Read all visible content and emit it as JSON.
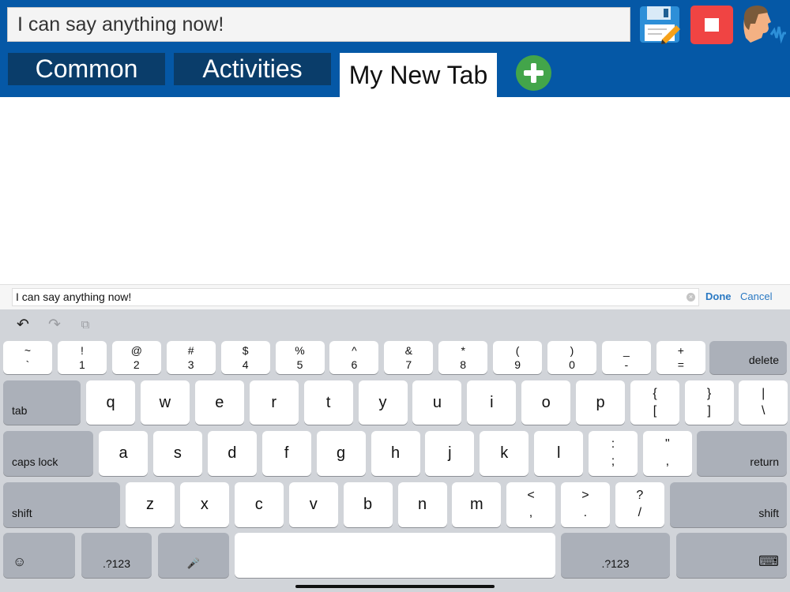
{
  "header": {
    "message_text": "I can say anything now!",
    "tabs": [
      {
        "label": "Common",
        "active": false
      },
      {
        "label": "Activities",
        "active": false
      },
      {
        "label": "My New Tab",
        "active": true
      }
    ],
    "icons": {
      "add": "add-tab-icon",
      "save": "save-icon",
      "stop": "stop-icon",
      "speak": "speak-icon"
    }
  },
  "edit_bar": {
    "value": "I can say anything now!",
    "clear": "×",
    "done": "Done",
    "cancel": "Cancel"
  },
  "toolbar": {
    "undo": "↶",
    "redo": "↷",
    "paste": "⧉"
  },
  "keyboard": {
    "row1": [
      {
        "top": "~",
        "bottom": "`"
      },
      {
        "top": "!",
        "bottom": "1"
      },
      {
        "top": "@",
        "bottom": "2"
      },
      {
        "top": "#",
        "bottom": "3"
      },
      {
        "top": "$",
        "bottom": "4"
      },
      {
        "top": "%",
        "bottom": "5"
      },
      {
        "top": "^",
        "bottom": "6"
      },
      {
        "top": "&",
        "bottom": "7"
      },
      {
        "top": "*",
        "bottom": "8"
      },
      {
        "top": "(",
        "bottom": "9"
      },
      {
        "top": ")",
        "bottom": "0"
      },
      {
        "top": "_",
        "bottom": "-"
      },
      {
        "top": "+",
        "bottom": "="
      }
    ],
    "delete": "delete",
    "tab": "tab",
    "row2": [
      "q",
      "w",
      "e",
      "r",
      "t",
      "y",
      "u",
      "i",
      "o",
      "p"
    ],
    "row2_sym": [
      {
        "top": "{",
        "bottom": "["
      },
      {
        "top": "}",
        "bottom": "]"
      },
      {
        "top": "|",
        "bottom": "\\"
      }
    ],
    "caps_lock": "caps lock",
    "row3": [
      "a",
      "s",
      "d",
      "f",
      "g",
      "h",
      "j",
      "k",
      "l"
    ],
    "row3_sym": [
      {
        "top": ":",
        "bottom": ";"
      },
      {
        "top": "\"",
        "bottom": ","
      }
    ],
    "return": "return",
    "shift": "shift",
    "row4": [
      "z",
      "x",
      "c",
      "v",
      "b",
      "n",
      "m"
    ],
    "row4_sym": [
      {
        "top": "<",
        "bottom": ","
      },
      {
        "top": ">",
        "bottom": "."
      },
      {
        "top": "?",
        "bottom": "/"
      }
    ],
    "emoji": "☺",
    "numbers": ".?123",
    "mic": "🎤",
    "hide": "⌨"
  }
}
